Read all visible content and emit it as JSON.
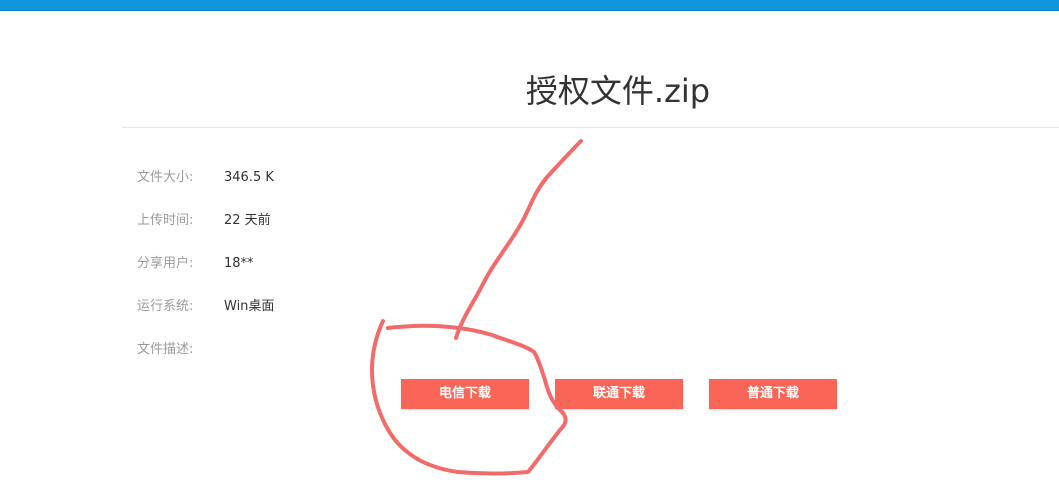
{
  "header": {
    "bar_color": "#1296db"
  },
  "file": {
    "title": "授权文件.zip"
  },
  "info": [
    {
      "label": "文件大小:",
      "value": "346.5 K"
    },
    {
      "label": "上传时间:",
      "value": "22 天前"
    },
    {
      "label": "分享用户:",
      "value": "18**"
    },
    {
      "label": "运行系统:",
      "value": "Win桌面"
    },
    {
      "label": "文件描述:",
      "value": ""
    }
  ],
  "buttons": {
    "telecom": "电信下载",
    "unicom": "联通下载",
    "normal": "普通下载",
    "color": "#f96556"
  },
  "annotation": {
    "color": "#f26b6b"
  }
}
